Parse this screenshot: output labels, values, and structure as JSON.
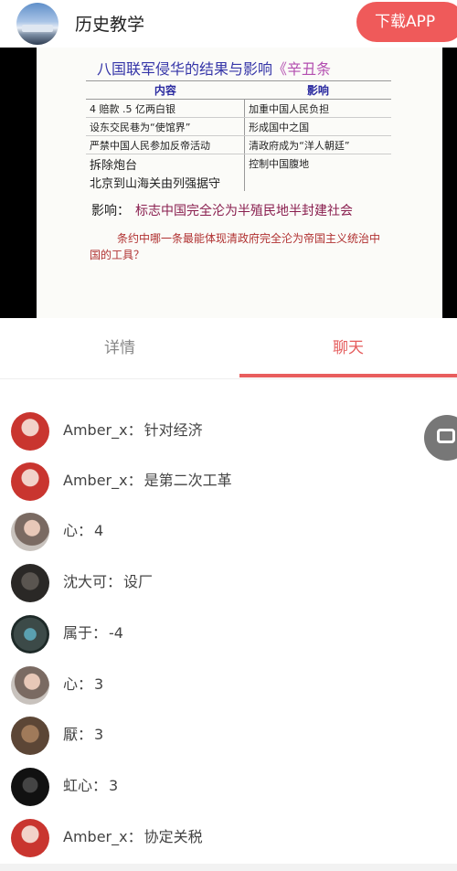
{
  "header": {
    "app_title": "历史教学",
    "download_label": "下载APP"
  },
  "slide": {
    "title": "八国联军侵华的结果与影响",
    "title_sub": "《辛丑条",
    "col_headers": [
      "内容",
      "影响"
    ],
    "rows": [
      [
        "4 赔款 .5 亿两白银",
        "加重中国人民负担"
      ],
      [
        "设东交民巷为“使馆界”",
        "形成国中之国"
      ],
      [
        "严禁中国人民参加反帝活动",
        "清政府成为“洋人朝廷”"
      ],
      [
        "拆除炮台",
        "控制中国腹地"
      ],
      [
        "北京到山海关由列强据守",
        ""
      ]
    ],
    "impact_label": "影响：",
    "impact_text": "标志中国完全沦为半殖民地半封建社会",
    "question": "条约中哪一条最能体现清政府完全沦为帝国主义统治中国的工具？"
  },
  "tabs": [
    {
      "label": "详情",
      "active": false
    },
    {
      "label": "聊天",
      "active": true
    }
  ],
  "chat": [
    {
      "user": "Amber_x",
      "sep": "：",
      "text": "针对经济",
      "avatar": "red-figure"
    },
    {
      "user": "Amber_x",
      "sep": "：",
      "text": "是第二次工革",
      "avatar": "red-figure"
    },
    {
      "user": "心",
      "sep": "：",
      "text": "4",
      "avatar": "girl-photo"
    },
    {
      "user": "沈大可",
      "sep": "：",
      "text": "设厂",
      "avatar": "dark-photo"
    },
    {
      "user": "属于",
      "sep": "：",
      "text": "-4",
      "avatar": "masked-photo"
    },
    {
      "user": "心",
      "sep": "：",
      "text": "3",
      "avatar": "girl-photo"
    },
    {
      "user": "厭",
      "sep": "：",
      "text": "3",
      "avatar": "brown-photo"
    },
    {
      "user": "虹心",
      "sep": "：",
      "text": "3",
      "avatar": "black-photo"
    },
    {
      "user": "Amber_x",
      "sep": "：",
      "text": "协定关税",
      "avatar": "red-figure"
    }
  ],
  "colors": {
    "accent": "#e85d5d",
    "download_button": "#ef5a5a"
  }
}
